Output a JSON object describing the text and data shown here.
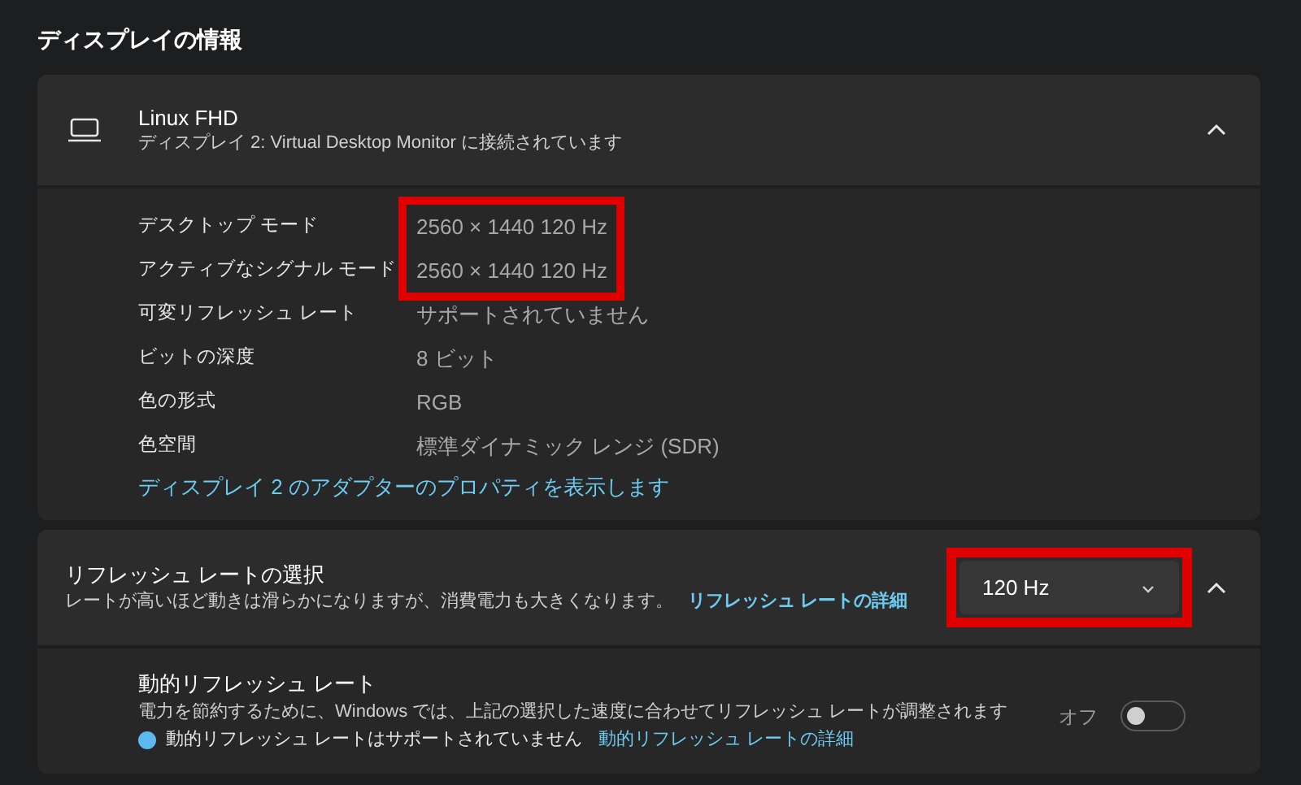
{
  "section_title": "ディスプレイの情報",
  "display_card": {
    "title": "Linux FHD",
    "subtitle": "ディスプレイ 2: Virtual Desktop Monitor に接続されています",
    "expanded": true,
    "rows": [
      {
        "label": "デスクトップ モード",
        "value": "2560 × 1440 120 Hz",
        "highlighted": true
      },
      {
        "label": "アクティブなシグナル モード",
        "value": "2560 × 1440 120 Hz",
        "highlighted": true
      },
      {
        "label": "可変リフレッシュ レート",
        "value": "サポートされていません",
        "highlighted": false
      },
      {
        "label": "ビットの深度",
        "value": "8 ビット",
        "highlighted": false
      },
      {
        "label": "色の形式",
        "value": "RGB",
        "highlighted": false
      },
      {
        "label": "色空間",
        "value": "標準ダイナミック レンジ (SDR)",
        "highlighted": false
      }
    ],
    "link": "ディスプレイ 2 のアダプターのプロパティを表示します"
  },
  "refresh_card": {
    "title": "リフレッシュ レートの選択",
    "description": "レートが高いほど動きは滑らかになりますが、消費電力も大きくなります。",
    "link": "リフレッシュ レートの詳細",
    "dropdown": {
      "value": "120 Hz",
      "highlighted": true
    },
    "expanded": true,
    "dynamic": {
      "title": "動的リフレッシュ レート",
      "description": "電力を節約するために、Windows では、上記の選択した速度に合わせてリフレッシュ レートが調整されます",
      "notice": "動的リフレッシュ レートはサポートされていません",
      "link": "動的リフレッシュ レートの詳細",
      "toggle_label": "オフ",
      "on": false
    }
  }
}
